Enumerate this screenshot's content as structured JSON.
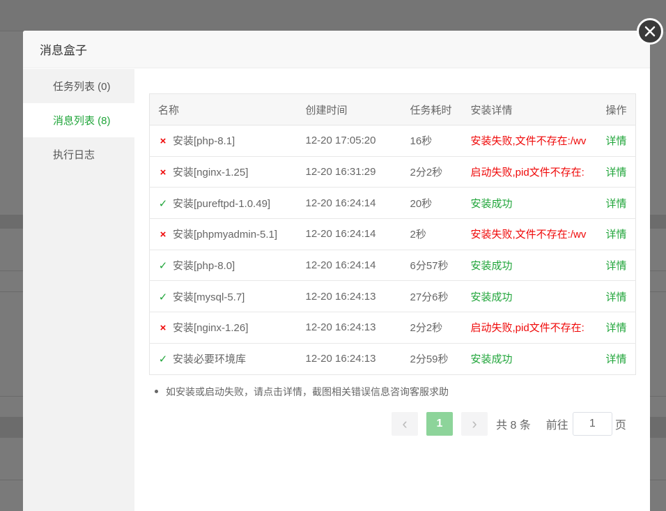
{
  "dialog": {
    "title": "消息盒子"
  },
  "sidebar": {
    "items": [
      {
        "label": "任务列表 (0)",
        "active": false
      },
      {
        "label": "消息列表 (8)",
        "active": true
      },
      {
        "label": "执行日志",
        "active": false
      }
    ]
  },
  "table": {
    "headers": [
      "名称",
      "创建时间",
      "任务耗时",
      "安装详情",
      "操作"
    ],
    "rows": [
      {
        "status": "fail",
        "name": "安装[php-8.1]",
        "created": "12-20 17:05:20",
        "duration": "16秒",
        "detail": "安装失败,文件不存在:/wv",
        "action": "详情"
      },
      {
        "status": "fail",
        "name": "安装[nginx-1.25]",
        "created": "12-20 16:31:29",
        "duration": "2分2秒",
        "detail": "启动失败,pid文件不存在:",
        "action": "详情"
      },
      {
        "status": "ok",
        "name": "安装[pureftpd-1.0.49]",
        "created": "12-20 16:24:14",
        "duration": "20秒",
        "detail": "安装成功",
        "action": "详情"
      },
      {
        "status": "fail",
        "name": "安装[phpmyadmin-5.1]",
        "created": "12-20 16:24:14",
        "duration": "2秒",
        "detail": "安装失败,文件不存在:/wv",
        "action": "详情"
      },
      {
        "status": "ok",
        "name": "安装[php-8.0]",
        "created": "12-20 16:24:14",
        "duration": "6分57秒",
        "detail": "安装成功",
        "action": "详情"
      },
      {
        "status": "ok",
        "name": "安装[mysql-5.7]",
        "created": "12-20 16:24:13",
        "duration": "27分6秒",
        "detail": "安装成功",
        "action": "详情"
      },
      {
        "status": "fail",
        "name": "安装[nginx-1.26]",
        "created": "12-20 16:24:13",
        "duration": "2分2秒",
        "detail": "启动失败,pid文件不存在:",
        "action": "详情"
      },
      {
        "status": "ok",
        "name": "安装必要环境库",
        "created": "12-20 16:24:13",
        "duration": "2分59秒",
        "detail": "安装成功",
        "action": "详情"
      }
    ]
  },
  "note": "如安装或启动失败，请点击详情，截图相关错误信息咨询客服求助",
  "pagination": {
    "current_page": "1",
    "total": "共 8 条",
    "goto_label": "前往",
    "goto_value": "1",
    "page_suffix": "页"
  },
  "icons": {
    "fail": "×",
    "ok": "✓",
    "prev": "‹",
    "next": "›"
  },
  "colors": {
    "accent": "#20a53a",
    "error": "#ef0808",
    "active_page": "#8dd49a"
  }
}
